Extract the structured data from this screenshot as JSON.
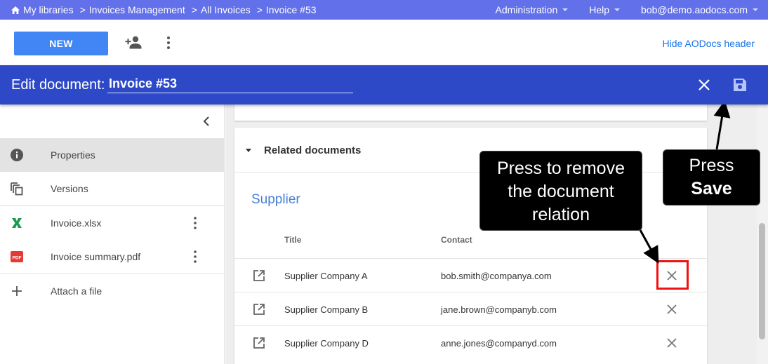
{
  "topbar": {
    "breadcrumbs": [
      "My libraries",
      "Invoices Management",
      "All Invoices",
      "Invoice #53"
    ],
    "separator": ">",
    "menu": [
      {
        "label": "Administration"
      },
      {
        "label": "Help"
      },
      {
        "label": "bob@demo.aodocs.com"
      }
    ]
  },
  "toolbar": {
    "new_label": "NEW",
    "hide_header_label": "Hide AODocs header"
  },
  "edit_header": {
    "label": "Edit document:",
    "title_value": "Invoice #53"
  },
  "sidebar": {
    "items": [
      {
        "label": "Properties",
        "icon": "info-icon"
      },
      {
        "label": "Versions",
        "icon": "versions-icon"
      },
      {
        "label": "Invoice.xlsx",
        "icon": "excel-icon"
      },
      {
        "label": "Invoice summary.pdf",
        "icon": "pdf-icon"
      },
      {
        "label": "Attach a file",
        "icon": "plus-icon"
      }
    ]
  },
  "related": {
    "header": "Related documents",
    "section": "Supplier",
    "columns": [
      "Title",
      "Contact"
    ],
    "rows": [
      {
        "title": "Supplier Company A",
        "contact": "bob.smith@companya.com"
      },
      {
        "title": "Supplier Company B",
        "contact": "jane.brown@companyb.com"
      },
      {
        "title": "Supplier Company D",
        "contact": "anne.jones@companyd.com"
      }
    ]
  },
  "annotations": {
    "remove_callout": [
      "Press to remove",
      "the document",
      "relation"
    ],
    "save_callout": [
      "Press",
      "Save"
    ]
  },
  "colors": {
    "topbar": "#6270ea",
    "edit_header": "#2e49c8",
    "primary_button": "#4285f4",
    "highlight": "#ee1111"
  }
}
